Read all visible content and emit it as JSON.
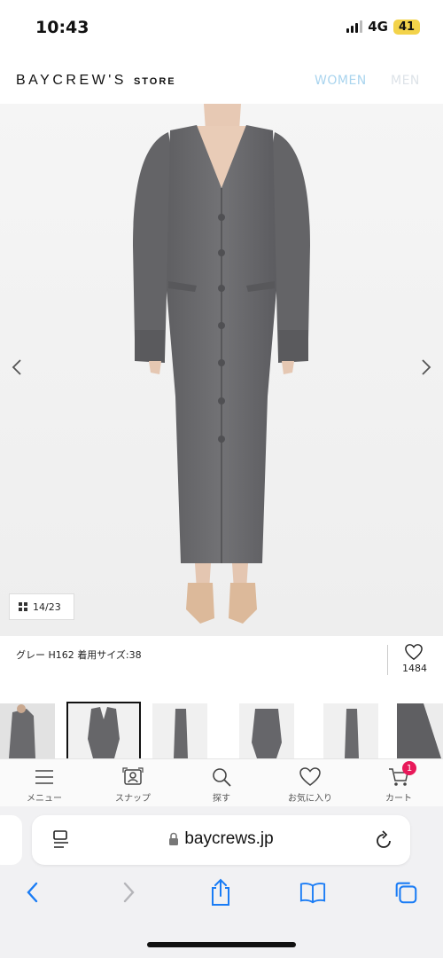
{
  "status_bar": {
    "time": "10:43",
    "network": "4G",
    "battery": "41"
  },
  "header": {
    "logo_main": "BAYCREW'S",
    "logo_sub": "STORE",
    "tab_women": "WOMEN",
    "tab_men": "MEN"
  },
  "product": {
    "image_counter": "14/23",
    "caption": "グレー H162 着用サイズ:38",
    "favorite_count": "1484"
  },
  "site_nav": {
    "items": [
      {
        "label": "メニュー",
        "icon": "menu-icon"
      },
      {
        "label": "スナップ",
        "icon": "snap-icon"
      },
      {
        "label": "探す",
        "icon": "search-icon"
      },
      {
        "label": "お気に入り",
        "icon": "heart-icon"
      },
      {
        "label": "カート",
        "icon": "cart-icon"
      }
    ],
    "cart_badge": "1"
  },
  "browser": {
    "url": "baycrews.jp"
  },
  "colors": {
    "women_tab": "#a9d4ee",
    "men_tab": "#dde3e8",
    "cart_badge": "#e8195a",
    "safari_blue": "#1a7cf5",
    "garment_gray": "#6b6b6e"
  }
}
